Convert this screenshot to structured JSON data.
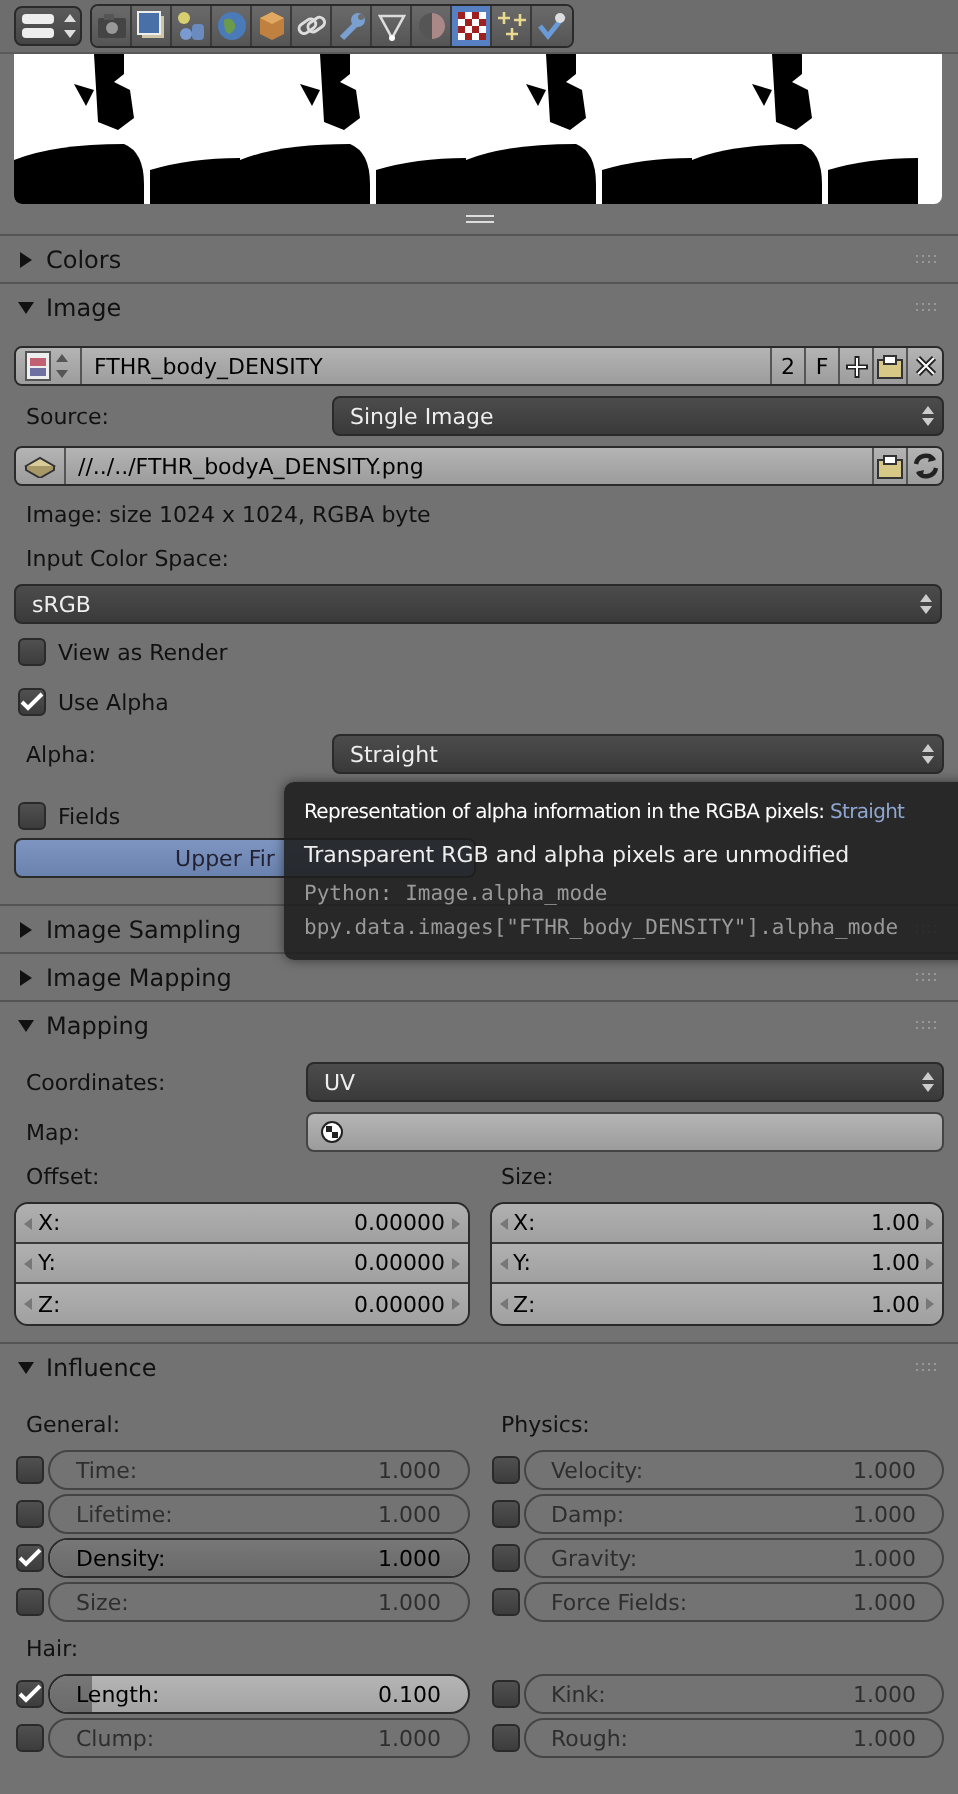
{
  "toolbar": {
    "tabs": [
      {
        "selected": false
      },
      {
        "selected": false
      },
      {
        "selected": false
      },
      {
        "selected": false
      },
      {
        "selected": false
      },
      {
        "selected": false
      },
      {
        "selected": false
      },
      {
        "selected": false
      },
      {
        "selected": false
      },
      {
        "selected": true
      },
      {
        "selected": false
      },
      {
        "selected": false
      }
    ]
  },
  "colors_panel": {
    "title": "Colors",
    "expanded": false
  },
  "image_panel": {
    "title": "Image",
    "expanded": true,
    "image_name": "FTHR_body_DENSITY",
    "users": "2",
    "fake_user": "F",
    "source_label": "Source:",
    "source": "Single Image",
    "filepath": "//../../FTHR_bodyA_DENSITY.png",
    "info": "Image: size 1024 x 1024, RGBA byte",
    "color_space_label": "Input Color Space:",
    "color_space": "sRGB",
    "checkboxes": [
      {
        "label": "View as Render",
        "checked": false
      },
      {
        "label": "Use Alpha",
        "checked": true
      }
    ],
    "alpha_label": "Alpha:",
    "alpha": "Straight",
    "fields": {
      "label": "Fields",
      "checked": false
    },
    "field_order": {
      "label": "Upper Fir",
      "selected": true
    }
  },
  "collapsed_panels": [
    {
      "title": "Image Sampling",
      "expanded": false
    },
    {
      "title": "Image Mapping",
      "expanded": false
    }
  ],
  "mapping_panel": {
    "title": "Mapping",
    "expanded": true,
    "coordinates_label": "Coordinates:",
    "coordinates": "UV",
    "map_label": "Map:",
    "offset_label": "Offset:",
    "size_label": "Size:",
    "offset": [
      {
        "axis": "X:",
        "value": "0.00000"
      },
      {
        "axis": "Y:",
        "value": "0.00000"
      },
      {
        "axis": "Z:",
        "value": "0.00000"
      }
    ],
    "size": [
      {
        "axis": "X:",
        "value": "1.00"
      },
      {
        "axis": "Y:",
        "value": "1.00"
      },
      {
        "axis": "Z:",
        "value": "1.00"
      }
    ]
  },
  "influence_panel": {
    "title": "Influence",
    "expanded": true,
    "groups": [
      {
        "title": "General:",
        "items": [
          {
            "label": "Time:",
            "value": "1.000",
            "checked": false
          },
          {
            "label": "Lifetime:",
            "value": "1.000",
            "checked": false
          },
          {
            "label": "Density:",
            "value": "1.000",
            "checked": true,
            "level": 1
          },
          {
            "label": "Size:",
            "value": "1.000",
            "checked": false
          }
        ]
      },
      {
        "title": "Physics:",
        "items": [
          {
            "label": "Velocity:",
            "value": "1.000",
            "checked": false
          },
          {
            "label": "Damp:",
            "value": "1.000",
            "checked": false
          },
          {
            "label": "Gravity:",
            "value": "1.000",
            "checked": false
          },
          {
            "label": "Force Fields:",
            "value": "1.000",
            "checked": false
          }
        ]
      },
      {
        "title": "Hair:",
        "items": [
          {
            "label": "Length:",
            "value": "0.100",
            "checked": true,
            "level": 0.1
          },
          {
            "label": "Clump:",
            "value": "1.000",
            "checked": false
          }
        ]
      },
      {
        "items": [
          {
            "label": "Kink:",
            "value": "1.000",
            "checked": false
          },
          {
            "label": "Rough:",
            "value": "1.000",
            "checked": false
          }
        ]
      }
    ]
  },
  "tooltip": {
    "title": "Representation of alpha information in the RGBA pixels:",
    "value": "Straight",
    "description": "Transparent RGB and alpha pixels are unmodified",
    "python": [
      "Python: Image.alpha_mode",
      "bpy.data.images[\"FTHR_body_DENSITY\"].alpha_mode"
    ]
  }
}
